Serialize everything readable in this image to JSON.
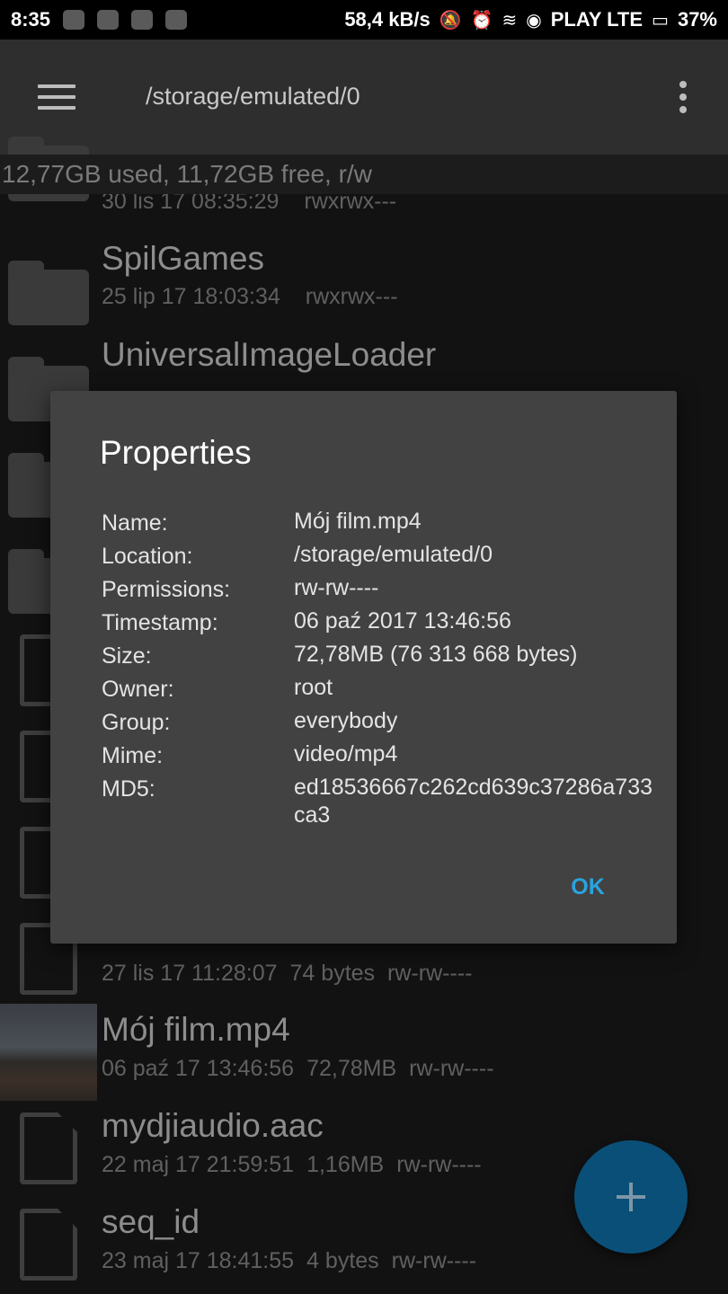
{
  "status_bar": {
    "time": "8:35",
    "net_speed": "58,4 kB/s",
    "carrier": "PLAY LTE",
    "battery": "37%",
    "icons": [
      "alarm-app-icon",
      "app-icon",
      "gallery-icon",
      "app-icon",
      "mute-icon",
      "alarm-icon",
      "wifi-icon",
      "signal-icon",
      "battery-icon"
    ]
  },
  "toolbar": {
    "path": "/storage/emulated/0",
    "menu_icon": "hamburger-menu-icon",
    "overflow_icon": "more-vert-icon"
  },
  "storage_info": "12,77GB used, 11,72GB free, r/w",
  "file_list": [
    {
      "name": "",
      "date": "30 lis 17 08:35:29",
      "size": "",
      "perms": "rwxrwx---",
      "type": "folder"
    },
    {
      "name": "SpilGames",
      "date": "25 lip 17 18:03:34",
      "size": "",
      "perms": "rwxrwx---",
      "type": "folder"
    },
    {
      "name": "UniversalImageLoader",
      "date": "",
      "size": "",
      "perms": "",
      "type": "folder"
    },
    {
      "name": "",
      "date": "",
      "size": "",
      "perms": "",
      "type": "folder"
    },
    {
      "name": "",
      "date": "",
      "size": "",
      "perms": "",
      "type": "folder"
    },
    {
      "name": "",
      "date": "",
      "size": "",
      "perms": "",
      "type": "file"
    },
    {
      "name": "",
      "date": "",
      "size": "",
      "perms": "",
      "type": "file"
    },
    {
      "name": "",
      "date": "",
      "size": "",
      "perms": "",
      "type": "file"
    },
    {
      "name": "",
      "date": "27 lis 17 11:28:07",
      "size": "74 bytes",
      "perms": "rw-rw----",
      "type": "file"
    },
    {
      "name": "Mój film.mp4",
      "date": "06 paź 17 13:46:56",
      "size": "72,78MB",
      "perms": "rw-rw----",
      "type": "video"
    },
    {
      "name": "mydjiaudio.aac",
      "date": "22 maj 17 21:59:51",
      "size": "1,16MB",
      "perms": "rw-rw----",
      "type": "file"
    },
    {
      "name": "seq_id",
      "date": "23 maj 17 18:41:55",
      "size": "4 bytes",
      "perms": "rw-rw----",
      "type": "file"
    }
  ],
  "dialog": {
    "title": "Properties",
    "properties": [
      {
        "label": "Name:",
        "value": "Mój film.mp4"
      },
      {
        "label": "Location:",
        "value": "/storage/emulated/0"
      },
      {
        "label": "Permissions:",
        "value": "rw-rw----"
      },
      {
        "label": "Timestamp:",
        "value": "06 paź 2017 13:46:56"
      },
      {
        "label": "Size:",
        "value": "72,78MB (76 313 668 bytes)"
      },
      {
        "label": "Owner:",
        "value": "root"
      },
      {
        "label": "Group:",
        "value": "everybody"
      },
      {
        "label": "Mime:",
        "value": "video/mp4"
      },
      {
        "label": "MD5:",
        "value": "ed18536667c262cd639c37286a733ca3"
      }
    ],
    "ok_label": "OK"
  },
  "fab": {
    "icon": "plus-icon"
  },
  "colors": {
    "accent": "#2aa3e0",
    "fab": "#0a4f78",
    "dialog_bg": "#424242",
    "toolbar_bg": "#2e2e2e"
  }
}
